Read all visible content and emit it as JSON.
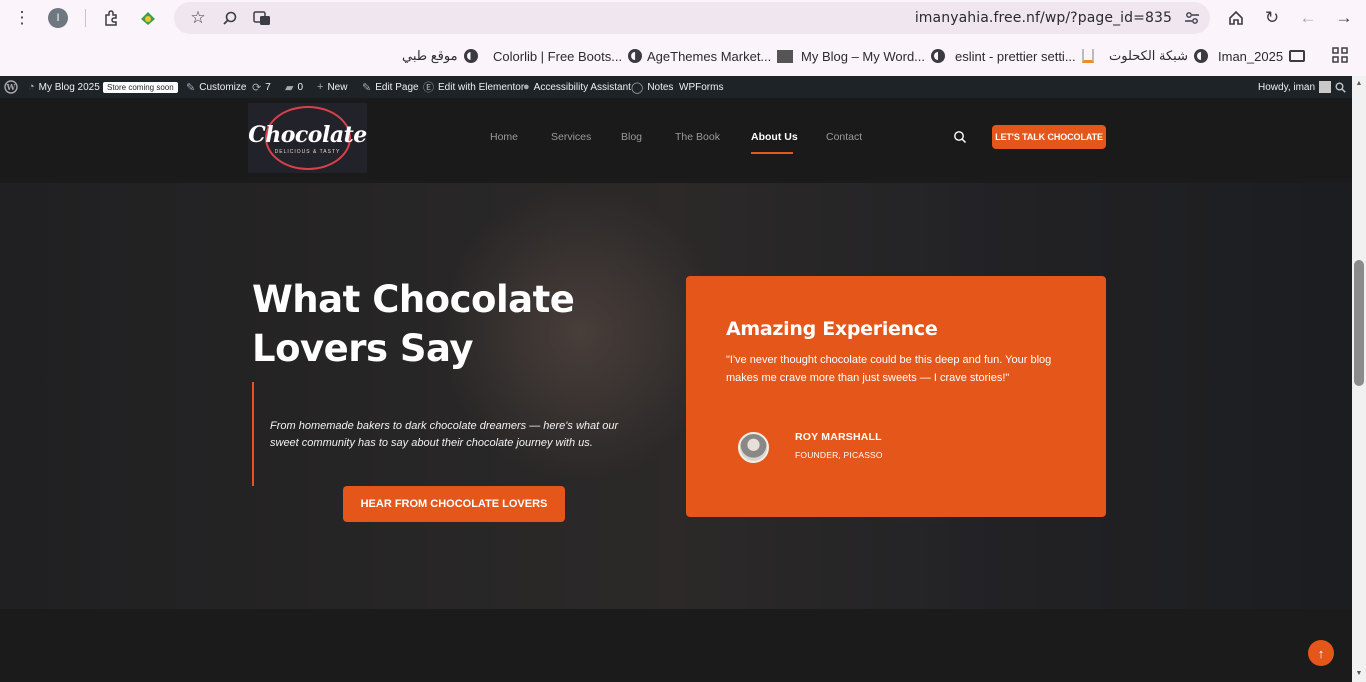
{
  "browser": {
    "url": "imanyahia.free.nf/wp/?page_id=835",
    "profile_initial": "I",
    "bookmarks": [
      {
        "label": "موقع طبي",
        "icon": "globe-icon"
      },
      {
        "label": "Colorlib | Free Boots...",
        "icon": "globe-icon"
      },
      {
        "label": "AgeThemes Market...",
        "icon": "globe-icon"
      },
      {
        "label": "My Blog – My Word...",
        "icon": "site-icon"
      },
      {
        "label": "eslint - prettier setti...",
        "icon": "globe-icon"
      },
      {
        "label": "شبكة الكحلوت",
        "icon": "stack-icon"
      },
      {
        "label": "Iman_2025",
        "icon": "globe-icon"
      }
    ]
  },
  "adminbar": {
    "site_name": "My Blog 2025",
    "badge": "Store coming soon",
    "customize": "Customize",
    "updates": "7",
    "comments": "0",
    "new": "New",
    "edit_page": "Edit Page",
    "elementor": "Edit with Elementor",
    "accessibility": "Accessibility Assistant",
    "notes": "Notes",
    "wpforms": "WPForms",
    "howdy": "Howdy, iman"
  },
  "header": {
    "logo_text": "Chocolate",
    "logo_sub": "DELICIOUS & TASTY",
    "nav": [
      "Home",
      "Services",
      "Blog",
      "The Book",
      "About Us",
      "Contact"
    ],
    "active_nav": "About Us",
    "cta": "LET'S TALK CHOCOLATE"
  },
  "hero": {
    "title": "What Chocolate Lovers Say",
    "description": "From homemade bakers to dark chocolate dreamers — here's what our sweet community has to say about their chocolate journey with us.",
    "button": "HEAR FROM CHOCOLATE LOVERS"
  },
  "testimonial": {
    "title": "Amazing Experience",
    "quote": "\"I've never thought chocolate could be this deep and fun. Your blog makes me crave more than just sweets — I crave stories!\"",
    "name": "ROY MARSHALL",
    "role": "FOUNDER, PICASSO"
  },
  "colors": {
    "accent": "#e4561a",
    "header_bg": "#1a1a1a",
    "adminbar_bg": "#1d2327"
  }
}
